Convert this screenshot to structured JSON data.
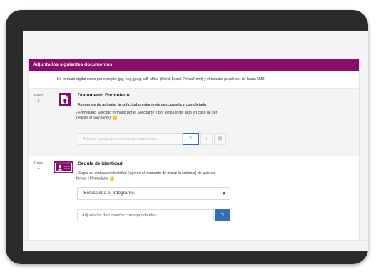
{
  "form": {
    "header_title": "Adjunta los siguientes documentos",
    "intro": "En formato digital como por ejemplo: jpg, png, jpeg, pdf, office (Word, Excel, PowerPoint) y el tamaño puede ser de hasta 6MB"
  },
  "steps": [
    {
      "paso_label": "Paso",
      "number": "3",
      "icon": "file-upload-icon",
      "title": "Documento Formulario",
      "subtitle": "Asegúrate de adjuntar la solicitud previamente descargada y completada",
      "bullet_line1": "Formulario Solicitud (firmado por el Solicitante y por el titular del dato en caso de ser",
      "bullet_line2": "distinto al solicitante)",
      "upload_placeholder": "Adjunta los documentos correspondientes"
    },
    {
      "paso_label": "Paso",
      "number": "4",
      "icon": "id-card-icon",
      "title": "Cédula de identidad",
      "bullet_line1": "Copia de cédula de identidad (vigente al momento de iniciar la solicitud) de quienes",
      "bullet_line2": "firman el formulario",
      "select_value": "Selecciona el Integrante..",
      "upload_placeholder": "Adjunta los documentos correspondientes"
    }
  ],
  "colors": {
    "brand": "#8a0c69",
    "primary_button": "#2f6fb5",
    "info_dot": "#f2b71d"
  }
}
